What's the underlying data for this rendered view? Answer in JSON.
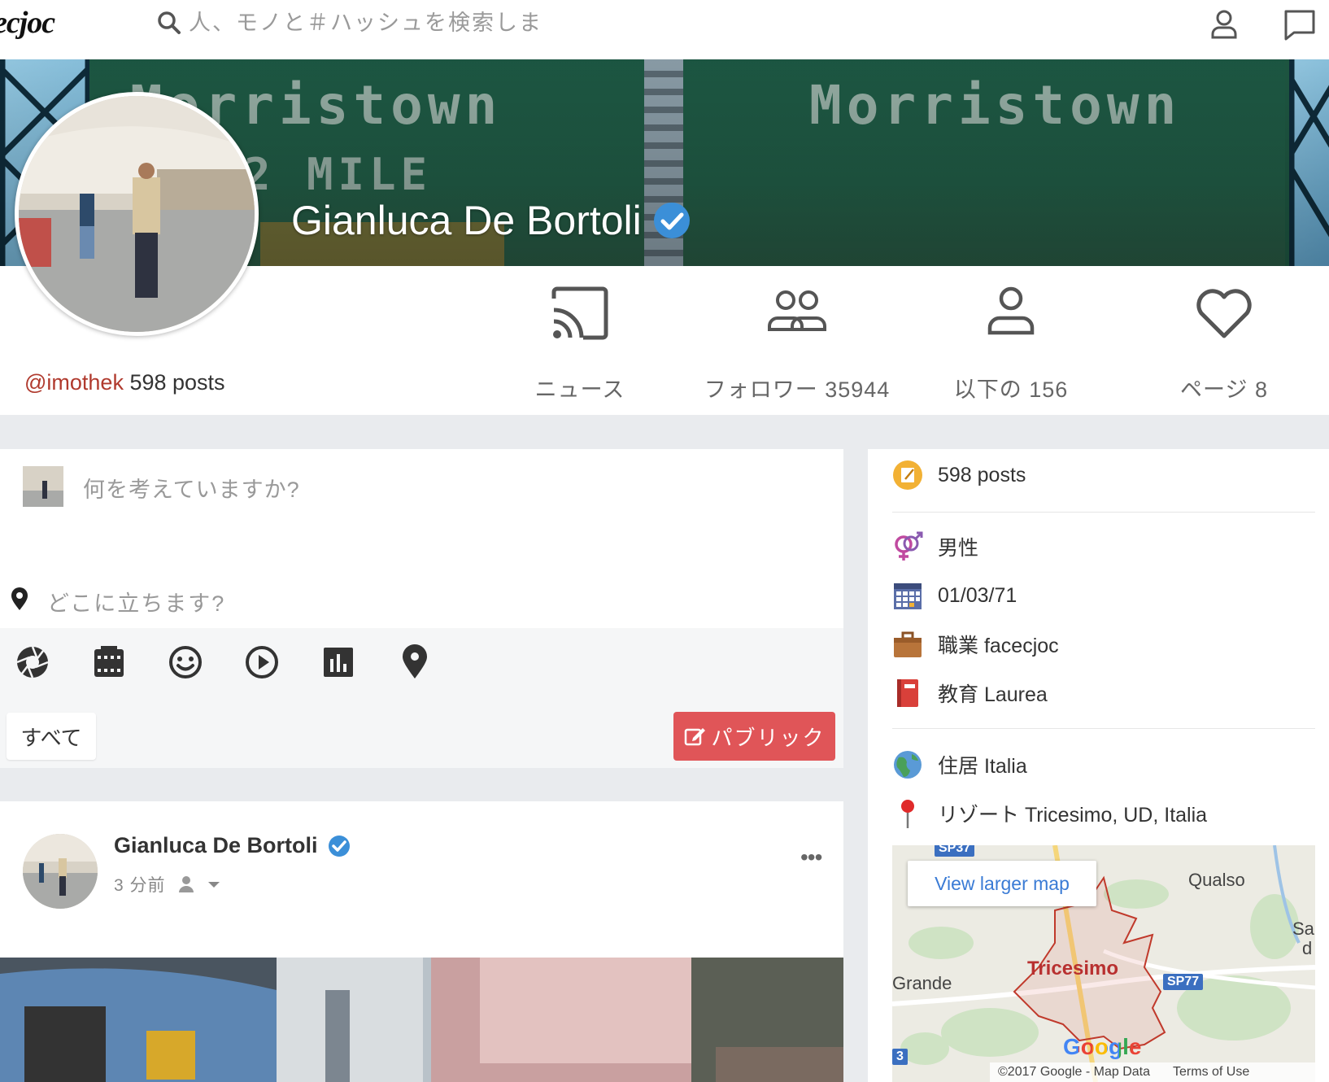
{
  "topbar": {
    "logo": "ecjoc",
    "search_placeholder": "人、モノと＃ハッシュを検索しま"
  },
  "profile": {
    "name": "Gianluca De Bortoli",
    "handle": "@imothek",
    "posts_count": "598 posts"
  },
  "stats": [
    {
      "label": "ニュース",
      "icon": "cast-icon"
    },
    {
      "label": "フォロワー 35944",
      "icon": "followers-icon"
    },
    {
      "label": "以下の 156",
      "icon": "following-icon"
    },
    {
      "label": "ページ 8",
      "icon": "heart-icon"
    }
  ],
  "composer": {
    "placeholder": "何を考えていますか?",
    "location_placeholder": "どこに立ちます?",
    "audience_label": "すべて",
    "publish_label": "パブリック"
  },
  "post": {
    "author": "Gianluca De Bortoli",
    "time": "3 分前",
    "more": "•••"
  },
  "sidebar": {
    "posts": "598 posts",
    "gender": "男性",
    "birthday": "01/03/71",
    "work": "職業 facecjoc",
    "education": "教育 Laurea",
    "lives_in": "住居 Italia",
    "from": "リゾート Tricesimo, UD, Italia"
  },
  "map": {
    "larger_map": "View larger map",
    "town": "Tricesimo",
    "places": [
      "Qualso",
      "Grande",
      "Sa",
      "d"
    ],
    "roads": [
      "SP77",
      "SP37",
      "3"
    ],
    "footer_copyright": "©2017 Google - Map Data",
    "footer_terms": "Terms of Use",
    "google": "Google"
  },
  "colors": {
    "accent_red": "#e05558",
    "verified_blue": "#3b8fd8",
    "handle_red": "#b03a2e"
  }
}
